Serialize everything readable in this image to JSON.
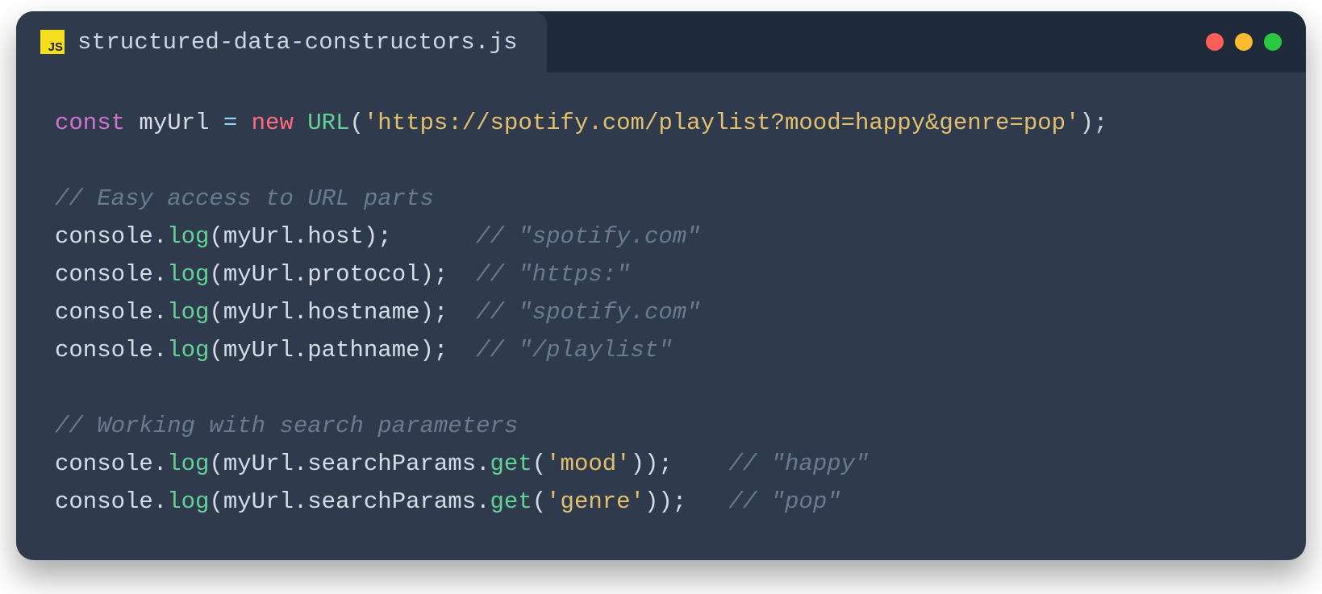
{
  "tab": {
    "icon_label": "JS",
    "filename": "structured-data-constructors.js"
  },
  "traffic": {
    "red": "#ff5f57",
    "yellow": "#febc2e",
    "green": "#28c840"
  },
  "code": {
    "l1": {
      "kw_const": "const",
      "ident": "myUrl",
      "eq": "=",
      "kw_new": "new",
      "type": "URL",
      "open": "(",
      "str": "'https://spotify.com/playlist?mood=happy&genre=pop'",
      "close": ")",
      "semi": ";"
    },
    "l3_comment": "// Easy access to URL parts",
    "l4": {
      "pre": "console.",
      "method": "log",
      "args": "(myUrl.host);",
      "pad": "      ",
      "comment": "// \"spotify.com\""
    },
    "l5": {
      "pre": "console.",
      "method": "log",
      "args": "(myUrl.protocol);",
      "pad": "  ",
      "comment": "// \"https:\""
    },
    "l6": {
      "pre": "console.",
      "method": "log",
      "args": "(myUrl.hostname);",
      "pad": "  ",
      "comment": "// \"spotify.com\""
    },
    "l7": {
      "pre": "console.",
      "method": "log",
      "args": "(myUrl.pathname);",
      "pad": "  ",
      "comment": "// \"/playlist\""
    },
    "l9_comment": "// Working with search parameters",
    "l10": {
      "pre": "console.",
      "method": "log",
      "open": "(myUrl.searchParams.",
      "get": "get",
      "inner": "(",
      "arg": "'mood'",
      "close": "));",
      "pad": "    ",
      "comment": "// \"happy\""
    },
    "l11": {
      "pre": "console.",
      "method": "log",
      "open": "(myUrl.searchParams.",
      "get": "get",
      "inner": "(",
      "arg": "'genre'",
      "close": "));",
      "pad": "   ",
      "comment": "// \"pop\""
    }
  }
}
